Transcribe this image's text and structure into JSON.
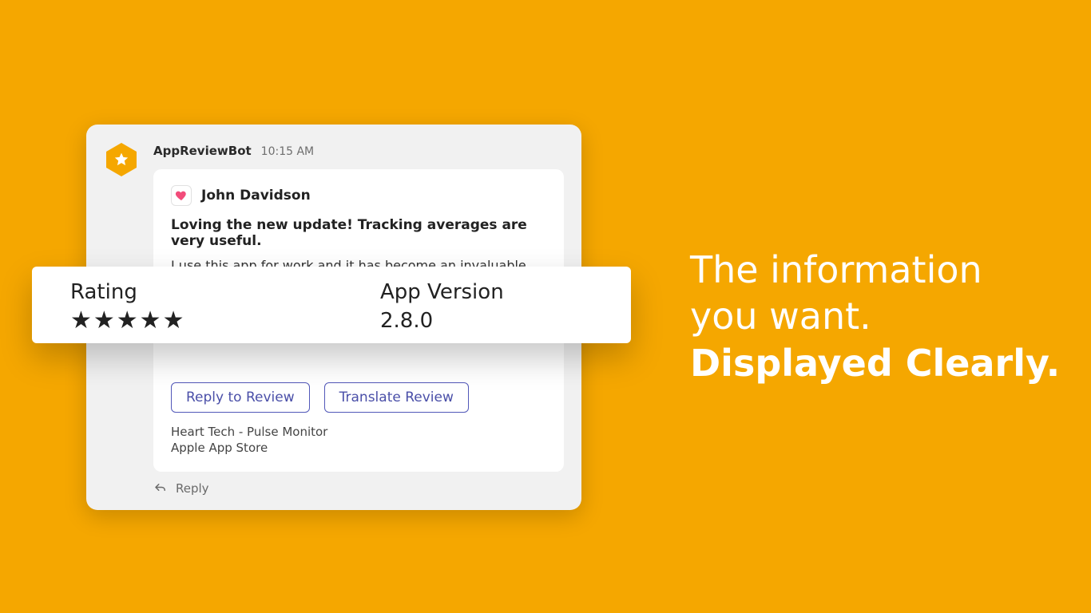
{
  "bot": {
    "name": "AppReviewBot",
    "time": "10:15 AM"
  },
  "review": {
    "author": "John Davidson",
    "title": "Loving the new update! Tracking averages are very useful.",
    "body": "I use this app for work and it has become an invaluable part of my"
  },
  "strip": {
    "rating_label": "Rating",
    "rating_stars": "★★★★★",
    "version_label": "App Version",
    "version_value": "2.8.0"
  },
  "buttons": {
    "reply": "Reply to Review",
    "translate": "Translate Review"
  },
  "footer": {
    "app_name": "Heart Tech - Pulse Monitor",
    "store": "Apple App Store"
  },
  "reply_label": "Reply",
  "hero": {
    "line1": "The information",
    "line2": "you want.",
    "line3": "Displayed Clearly."
  }
}
